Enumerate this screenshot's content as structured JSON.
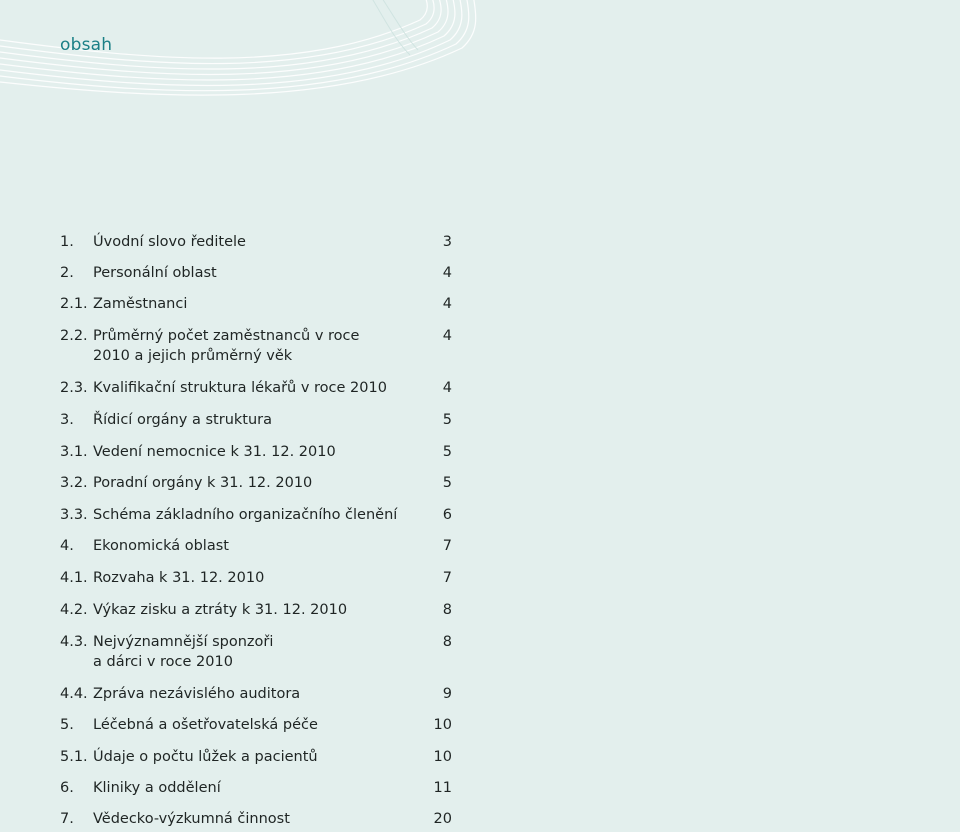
{
  "page": {
    "title": "obsah"
  },
  "toc": {
    "items": [
      {
        "num": "1.",
        "title": "Úvodní slovo ředitele",
        "page": "3"
      },
      {
        "num": "2.",
        "title": "Personální oblast",
        "page": "4"
      },
      {
        "num": "2.1.",
        "title": "Zaměstnanci",
        "page": "4"
      },
      {
        "num": "2.2.",
        "title": "Průměrný počet zaměstnanců v roce 2010 a jejich průměrný věk",
        "page": "4"
      },
      {
        "num": "2.3.",
        "title": "Kvalifikační struktura lékařů v roce 2010",
        "page": "4"
      },
      {
        "num": "3.",
        "title": "Řídicí orgány a struktura",
        "page": "5"
      },
      {
        "num": "3.1.",
        "title": "Vedení nemocnice k 31. 12. 2010",
        "page": "5"
      },
      {
        "num": "3.2.",
        "title": "Poradní orgány k 31. 12. 2010",
        "page": "5"
      },
      {
        "num": "3.3.",
        "title": "Schéma základního organizačního členění",
        "page": "6"
      },
      {
        "num": "4.",
        "title": "Ekonomická oblast",
        "page": "7"
      },
      {
        "num": "4.1.",
        "title": "Rozvaha k 31. 12. 2010",
        "page": "7"
      },
      {
        "num": "4.2.",
        "title": "Výkaz zisku a ztráty k 31. 12. 2010",
        "page": "8"
      },
      {
        "num": "4.3.",
        "title": "Nejvýznamnější sponzoři a dárci v roce 2010",
        "page": "8"
      },
      {
        "num": "4.4.",
        "title": "Zpráva nezávislého auditora",
        "page": "9"
      },
      {
        "num": "5.",
        "title": "Léčebná a ošetřovatelská péče",
        "page": "10"
      },
      {
        "num": "5.1.",
        "title": "Údaje o počtu lůžek a pacientů",
        "page": "10"
      },
      {
        "num": "6.",
        "title": "Kliniky a oddělení",
        "page": "11"
      },
      {
        "num": "7.",
        "title": "Vědecko-výzkumná činnost",
        "page": "20"
      }
    ]
  }
}
